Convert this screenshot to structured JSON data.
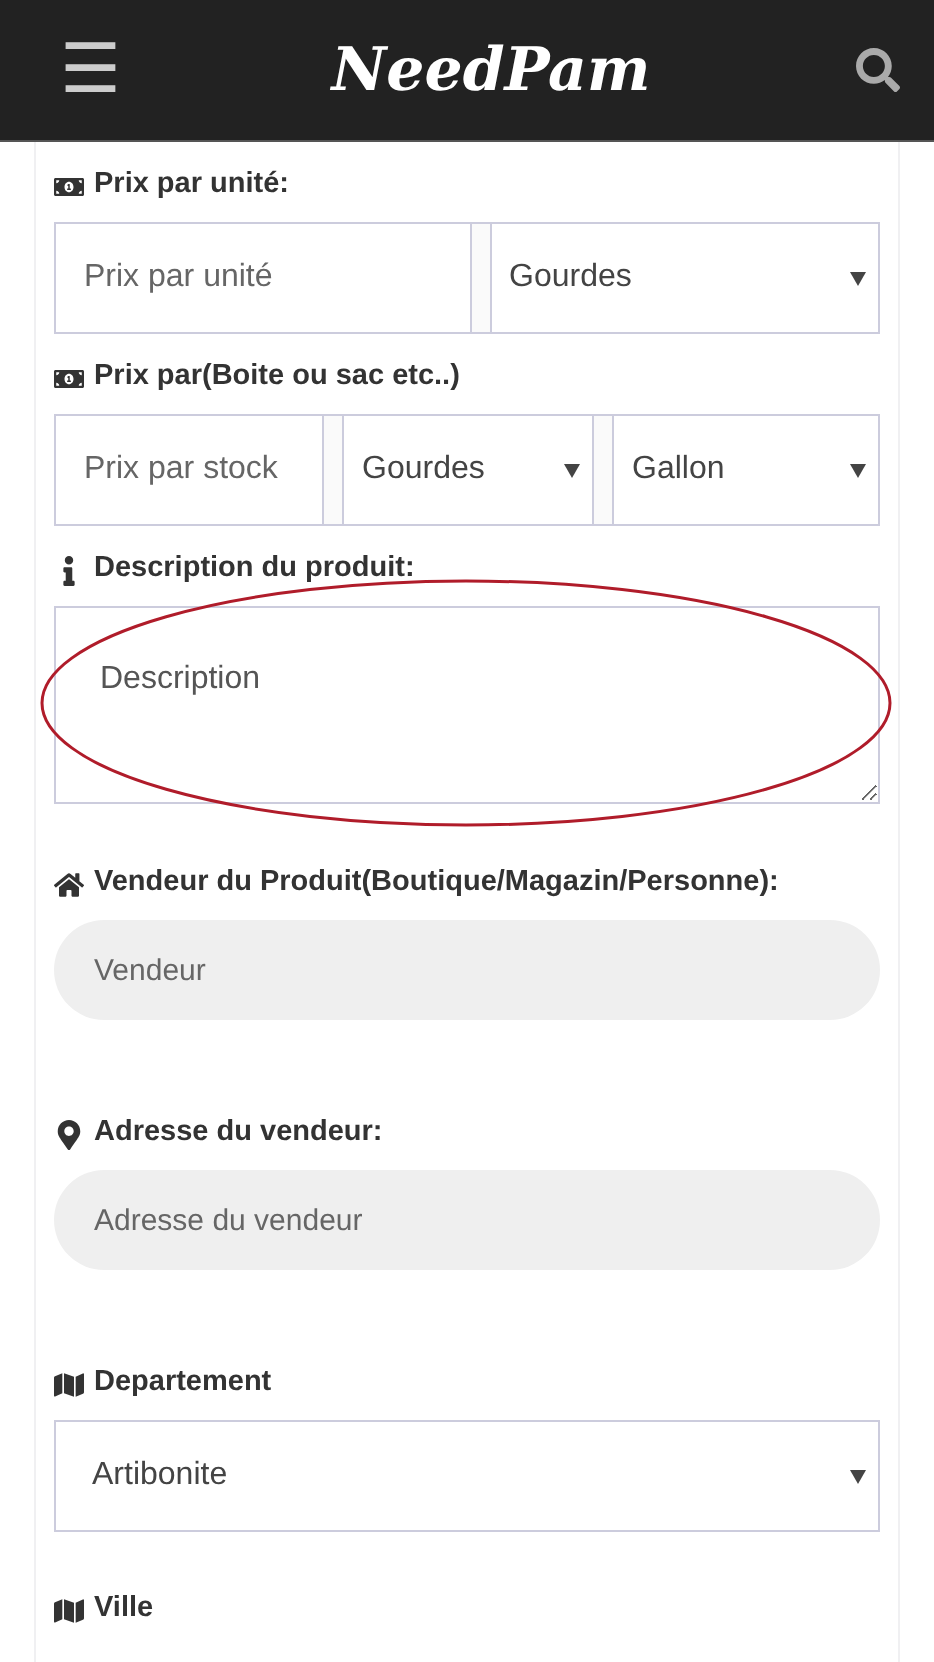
{
  "header": {
    "menu_label": "☰",
    "logo": "NeedPam"
  },
  "sections": [
    {
      "kind": "price",
      "label": "Prix par unité:",
      "controls": [
        {
          "kind": "input",
          "placeholder": "Prix par unité"
        },
        {
          "kind": "select",
          "value": "Gourdes"
        }
      ]
    },
    {
      "kind": "price",
      "label": "Prix par(Boite ou sac etc..)",
      "controls": [
        {
          "kind": "input",
          "placeholder": "Prix par stock"
        },
        {
          "kind": "select",
          "value": "Gourdes"
        },
        {
          "kind": "select",
          "value": "Gallon"
        }
      ]
    },
    {
      "kind": "description",
      "label": "Description du produit:",
      "controls": [
        {
          "kind": "textarea",
          "placeholder": "Description",
          "highlighted": true
        }
      ]
    },
    {
      "kind": "seller",
      "label": "Vendeur du Produit(Boutique/Magazin/Personne):",
      "controls": [
        {
          "kind": "pill",
          "placeholder": "Vendeur"
        }
      ]
    },
    {
      "kind": "address",
      "label": "Adresse du vendeur:",
      "controls": [
        {
          "kind": "pill",
          "placeholder": "Adresse du vendeur"
        }
      ]
    },
    {
      "kind": "department",
      "label": "Departement",
      "controls": [
        {
          "kind": "select",
          "value": "Artibonite"
        }
      ]
    },
    {
      "kind": "city",
      "label": "Ville"
    }
  ]
}
